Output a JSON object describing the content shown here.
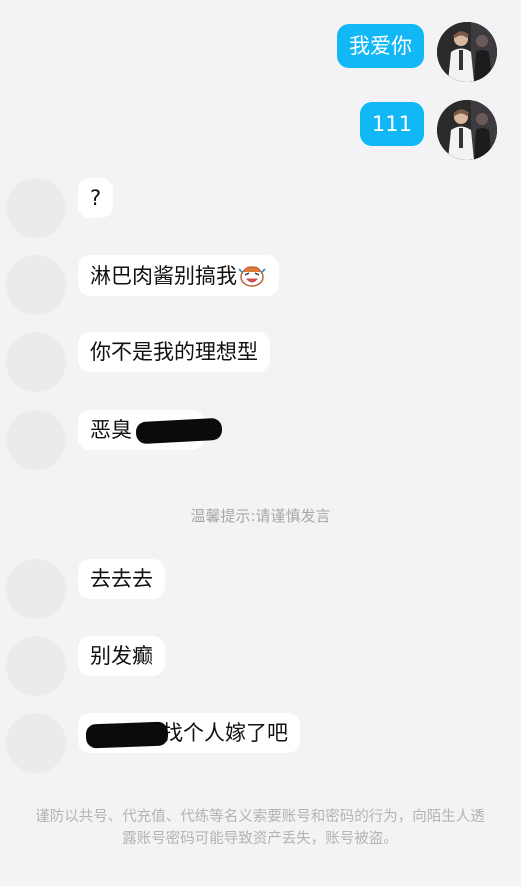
{
  "messages": [
    {
      "side": "out",
      "text": "我爱你"
    },
    {
      "side": "out",
      "text": "111"
    },
    {
      "side": "in",
      "text": "?"
    },
    {
      "side": "in",
      "text": "淋巴肉酱别搞我"
    },
    {
      "side": "in",
      "text": "你不是我的理想型"
    },
    {
      "side": "in",
      "text": "恶臭"
    },
    {
      "side": "in",
      "text": "去去去"
    },
    {
      "side": "in",
      "text": "别发癫"
    },
    {
      "side": "in",
      "text": "找个人嫁了吧"
    }
  ],
  "system_tip": "温馨提示:请谨慎发言",
  "footer_notice": "谨防以共号、代充值、代练等名义索要账号和密码的行为，向陌生人透露账号密码可能导致资产丢失，账号被盗。",
  "colors": {
    "outgoing_bubble": "#12b7f5",
    "incoming_bubble": "#ffffff",
    "background": "#f3f3f5"
  },
  "icons": {
    "sticker": "laughing-face-emoji",
    "redaction": "black-scribble"
  }
}
